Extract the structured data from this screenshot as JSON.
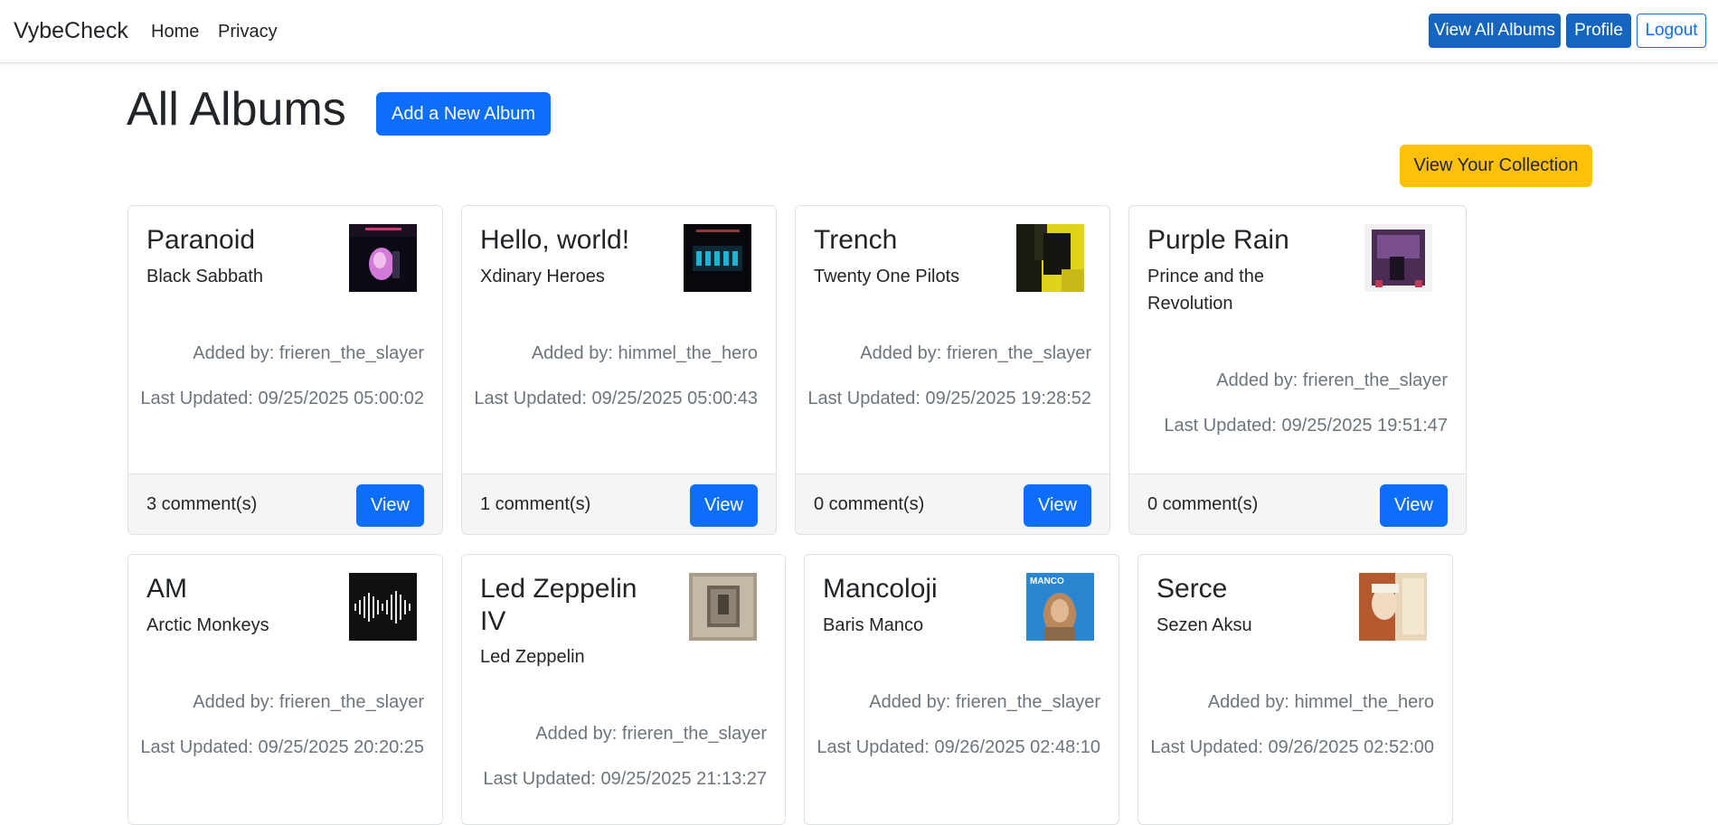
{
  "nav": {
    "brand": "VybeCheck",
    "home": "Home",
    "privacy": "Privacy",
    "view_all_albums": "View All Albums",
    "profile": "Profile",
    "logout": "Logout"
  },
  "page": {
    "title": "All Albums",
    "add_button": "Add a New Album",
    "collection_button": "View Your Collection"
  },
  "albums": [
    {
      "title": "Paranoid",
      "artist": "Black Sabbath",
      "added_by": "Added by: frieren_the_slayer",
      "updated": "Last Updated: 09/25/2025 05:00:02",
      "comments": "3 comment(s)",
      "view": "View"
    },
    {
      "title": "Hello, world!",
      "artist": "Xdinary Heroes",
      "added_by": "Added by: himmel_the_hero",
      "updated": "Last Updated: 09/25/2025 05:00:43",
      "comments": "1 comment(s)",
      "view": "View"
    },
    {
      "title": "Trench",
      "artist": "Twenty One Pilots",
      "added_by": "Added by: frieren_the_slayer",
      "updated": "Last Updated: 09/25/2025 19:28:52",
      "comments": "0 comment(s)",
      "view": "View"
    },
    {
      "title": "Purple Rain",
      "artist": "Prince and the Revolution",
      "added_by": "Added by: frieren_the_slayer",
      "updated": "Last Updated: 09/25/2025 19:51:47",
      "comments": "0 comment(s)",
      "view": "View"
    },
    {
      "title": "AM",
      "artist": "Arctic Monkeys",
      "added_by": "Added by: frieren_the_slayer",
      "updated": "Last Updated: 09/25/2025 20:20:25"
    },
    {
      "title": "Led Zeppelin IV",
      "artist": "Led Zeppelin",
      "added_by": "Added by: frieren_the_slayer",
      "updated": "Last Updated: 09/25/2025 21:13:27"
    },
    {
      "title": "Mancoloji",
      "artist": "Baris Manco",
      "added_by": "Added by: frieren_the_slayer",
      "updated": "Last Updated: 09/26/2025 02:48:10",
      "cover_text": "MANCO"
    },
    {
      "title": "Serce",
      "artist": "Sezen Aksu",
      "added_by": "Added by: himmel_the_hero",
      "updated": "Last Updated: 09/26/2025 02:52:00"
    }
  ],
  "colors": {
    "primary": "#0d6efd",
    "nav_primary": "#1565c0",
    "warning": "#ffc107",
    "muted": "#6c757d"
  }
}
